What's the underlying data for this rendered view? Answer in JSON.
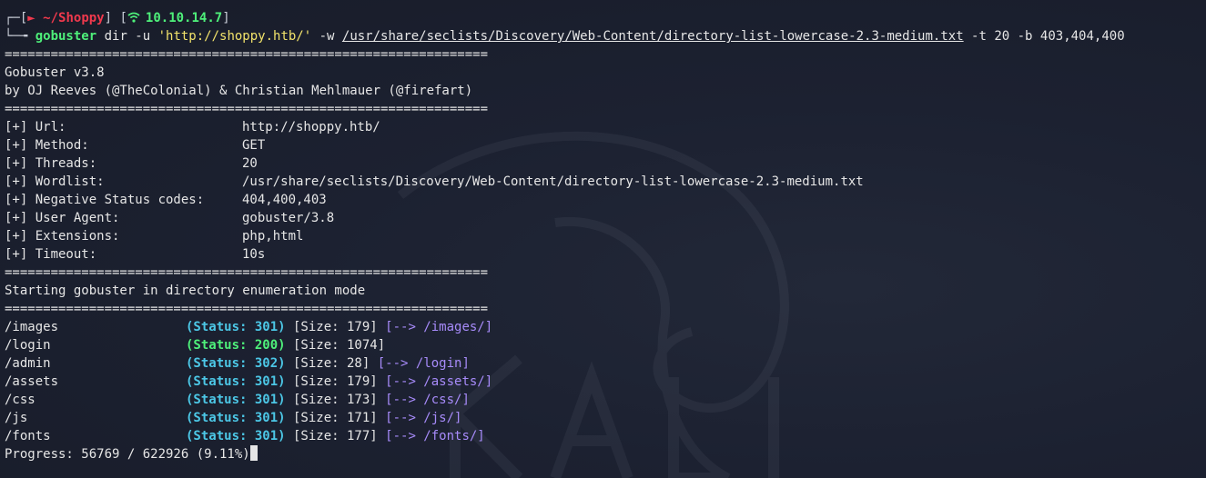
{
  "prompt": {
    "frame_top": "┌─[",
    "arrow_glyph": "►",
    "directory": "~/Shoppy",
    "mid": "] [",
    "ip": "10.10.14.7",
    "close": "]",
    "frame_bottom": "└─╼ ",
    "icon": "wifi-icon"
  },
  "command": {
    "program": "gobuster",
    "args_1": " dir -u ",
    "url_arg": "'http://shoppy.htb/'",
    "args_2": " -w ",
    "wordlist_arg": "/usr/share/seclists/Discovery/Web-Content/directory-list-lowercase-2.3-medium.txt",
    "args_3": " -t 20 -b 403,404,400"
  },
  "separator": "===============================================================",
  "banner": {
    "title": "Gobuster v3.8",
    "authors": "by OJ Reeves (@TheColonial) & Christian Mehlmauer (@firefart)"
  },
  "config": [
    {
      "key": "[+] Url:",
      "value": "http://shoppy.htb/"
    },
    {
      "key": "[+] Method:",
      "value": "GET"
    },
    {
      "key": "[+] Threads:",
      "value": "20"
    },
    {
      "key": "[+] Wordlist:",
      "value": "/usr/share/seclists/Discovery/Web-Content/directory-list-lowercase-2.3-medium.txt"
    },
    {
      "key": "[+] Negative Status codes:",
      "value": "404,400,403"
    },
    {
      "key": "[+] User Agent:",
      "value": "gobuster/3.8"
    },
    {
      "key": "[+] Extensions:",
      "value": "php,html"
    },
    {
      "key": "[+] Timeout:",
      "value": "10s"
    }
  ],
  "mode_line": "Starting gobuster in directory enumeration mode",
  "results": [
    {
      "path": "/images",
      "status": "(Status: 301)",
      "size": " [Size: 179] ",
      "redirect": "[--> /images/]",
      "ok": false
    },
    {
      "path": "/login",
      "status": "(Status: 200)",
      "size": " [Size: 1074]",
      "redirect": "",
      "ok": true
    },
    {
      "path": "/admin",
      "status": "(Status: 302)",
      "size": " [Size: 28] ",
      "redirect": "[--> /login]",
      "ok": false
    },
    {
      "path": "/assets",
      "status": "(Status: 301)",
      "size": " [Size: 179] ",
      "redirect": "[--> /assets/]",
      "ok": false
    },
    {
      "path": "/css",
      "status": "(Status: 301)",
      "size": " [Size: 173] ",
      "redirect": "[--> /css/]",
      "ok": false
    },
    {
      "path": "/js",
      "status": "(Status: 301)",
      "size": " [Size: 171] ",
      "redirect": "[--> /js/]",
      "ok": false
    },
    {
      "path": "/fonts",
      "status": "(Status: 301)",
      "size": " [Size: 177] ",
      "redirect": "[--> /fonts/]",
      "ok": false
    }
  ],
  "progress": "Progress: 56769 / 622926 (9.11%)",
  "colors": {
    "background": "#1b2030",
    "prompt_red": "#f0394d",
    "green": "#4ef07a",
    "string_yellow": "#f2e36b",
    "status_cyan": "#4cc7e6",
    "redirect_purple": "#a78bfa"
  }
}
